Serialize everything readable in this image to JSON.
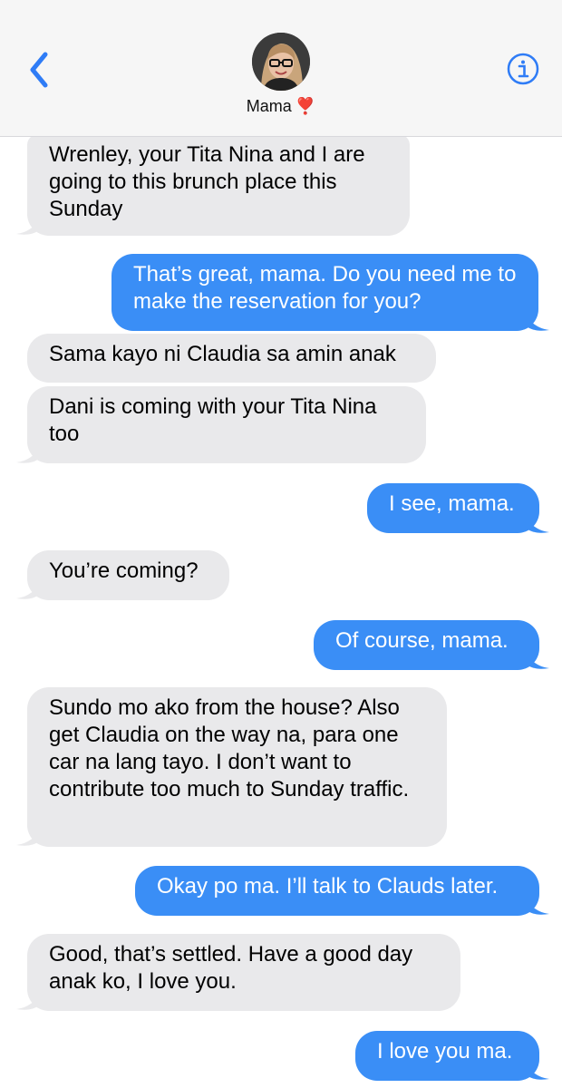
{
  "header": {
    "contact_name": "Mama",
    "contact_emoji": "❣️",
    "back_icon": "chevron-left-icon",
    "info_icon": "info-icon"
  },
  "colors": {
    "incoming_bubble": "#e9e9eb",
    "outgoing_bubble": "#3a8ef6",
    "accent": "#2f7cf6"
  },
  "messages": [
    {
      "from": "incoming",
      "text": "Wrenley, your Tita Nina and I are going to this brunch place this Sunday"
    },
    {
      "from": "outgoing",
      "text": "That’s great, mama. Do you need me to make the reservation for you?"
    },
    {
      "from": "incoming",
      "text": "Sama kayo ni Claudia sa amin anak"
    },
    {
      "from": "incoming",
      "text": "Dani is coming with your Tita Nina too"
    },
    {
      "from": "outgoing",
      "text": "I see, mama."
    },
    {
      "from": "incoming",
      "text": "You’re coming?"
    },
    {
      "from": "outgoing",
      "text": "Of course, mama."
    },
    {
      "from": "incoming",
      "text": "Sundo mo ako from the house? Also get Claudia on the way na, para one car na lang tayo. I don’t want to contribute too much to Sunday traffic."
    },
    {
      "from": "outgoing",
      "text": "Okay po ma. I’ll talk to Clauds later."
    },
    {
      "from": "incoming",
      "text": "Good, that’s settled. Have a good day anak ko, I love you."
    },
    {
      "from": "outgoing",
      "text": "I love you ma."
    }
  ]
}
